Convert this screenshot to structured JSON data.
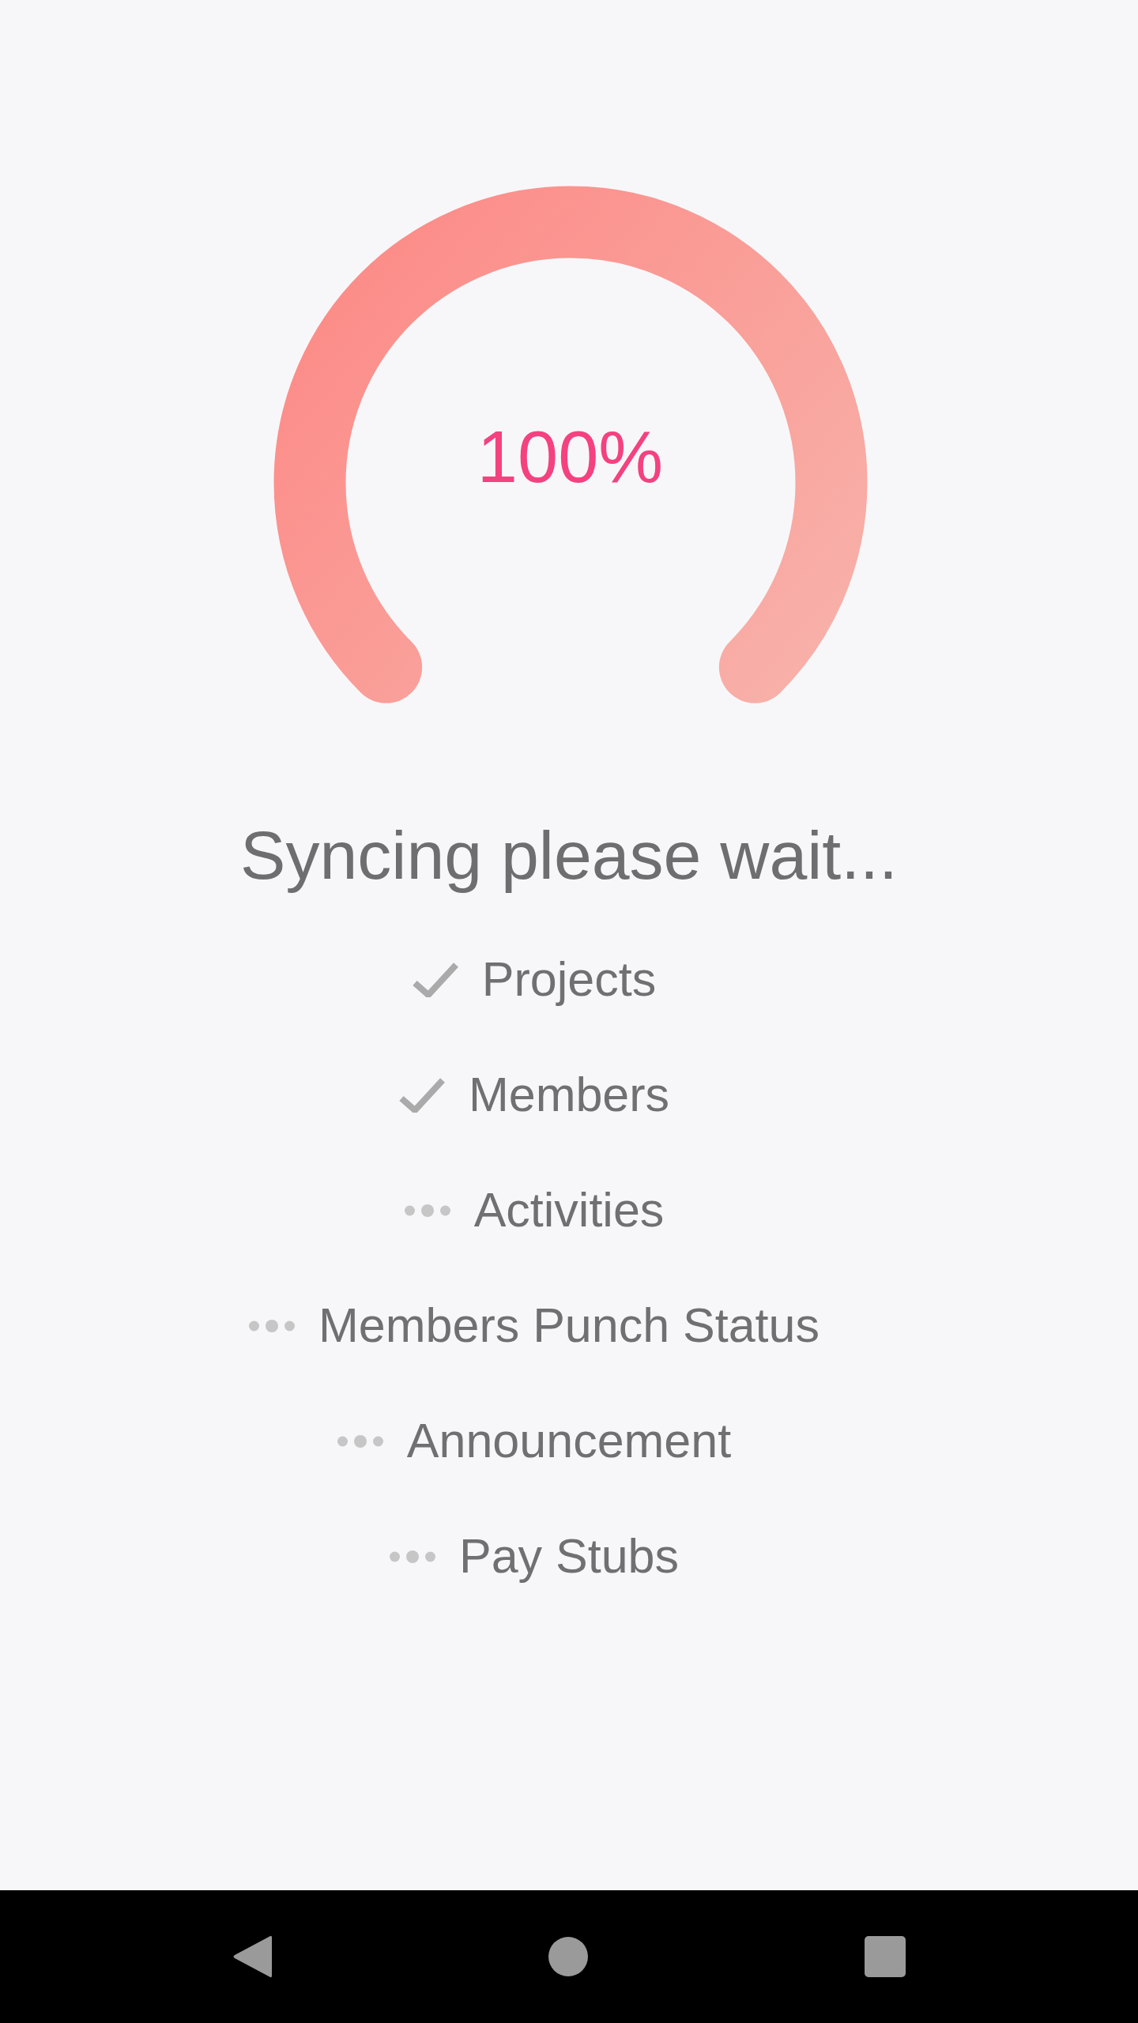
{
  "gauge": {
    "level": 1,
    "reading": "100%"
  },
  "title": "Syncing please wait...",
  "items": [
    {
      "label": "Projects",
      "done": true
    },
    {
      "label": "Members",
      "done": true
    },
    {
      "label": "Activities",
      "done": false
    },
    {
      "label": "Members Punch Status",
      "done": false
    },
    {
      "label": "Announcement",
      "done": false
    },
    {
      "label": "Pay Stubs",
      "done": false
    }
  ]
}
